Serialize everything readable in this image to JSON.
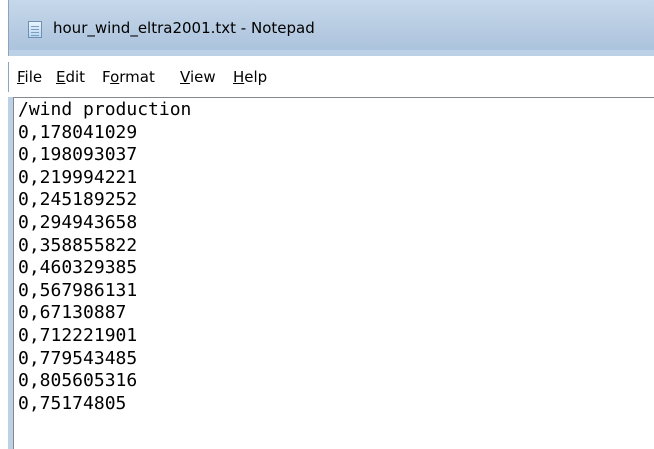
{
  "window": {
    "title": "hour_wind_eltra2001.txt - Notepad"
  },
  "menu": [
    {
      "mnemonic": "F",
      "rest": "ile"
    },
    {
      "mnemonic": "E",
      "rest": "dit"
    },
    {
      "pre": "F",
      "mnemonic": "o",
      "rest": "rmat"
    },
    {
      "mnemonic": "V",
      "rest": "iew"
    },
    {
      "mnemonic": "H",
      "rest": "elp"
    }
  ],
  "editor": {
    "lines": [
      "/wind production",
      "0,178041029",
      "0,198093037",
      "0,219994221",
      "0,245189252",
      "0,294943658",
      "0,358855822",
      "0,460329385",
      "0,567986131",
      "0,67130887",
      "0,712221901",
      "0,779543485",
      "0,805605316",
      "0,75174805"
    ]
  },
  "icons": {
    "app": "notepad-icon"
  }
}
